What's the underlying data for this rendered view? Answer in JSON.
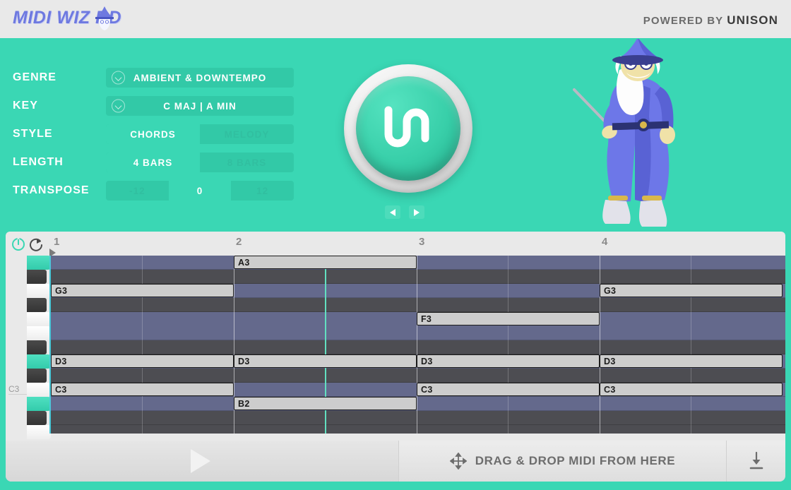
{
  "header": {
    "logo_text": "MIDI WIZ RD",
    "logo_icon": "wizard-hat-icon",
    "powered_prefix": "POWERED BY ",
    "powered_brand": "UNISON"
  },
  "controls": {
    "genre": {
      "label": "GENRE",
      "value": "AMBIENT & DOWNTEMPO",
      "icon": "chevron-down-circle-icon"
    },
    "key": {
      "label": "KEY",
      "value": "C MAJ | A MIN",
      "icon": "chevron-down-circle-icon"
    },
    "style": {
      "label": "STYLE",
      "options": [
        "CHORDS",
        "MELODY"
      ],
      "selected": "CHORDS"
    },
    "length": {
      "label": "LENGTH",
      "options": [
        "4 BARS",
        "8 BARS"
      ],
      "selected": "4 BARS"
    },
    "transpose": {
      "label": "TRANSPOSE",
      "options": [
        "-12",
        "0",
        "12"
      ],
      "selected": "0"
    }
  },
  "generate": {
    "icon": "unison-logo-icon",
    "prev_icon": "previous-arrow-icon",
    "next_icon": "next-arrow-icon"
  },
  "mascot": {
    "name": "wizard-illustration"
  },
  "piano_roll": {
    "power_icon": "power-icon",
    "loop_icon": "loop-icon",
    "bars": [
      "1",
      "2",
      "3",
      "4"
    ],
    "octave_label": "C3",
    "playhead_bar": 1.75,
    "notes": [
      {
        "name": "A3",
        "start_bar": 2.0,
        "length_bars": 1.0,
        "row": 0
      },
      {
        "name": "G3",
        "start_bar": 1.0,
        "length_bars": 1.0,
        "row": 2
      },
      {
        "name": "G3",
        "start_bar": 4.0,
        "length_bars": 1.0,
        "row": 2
      },
      {
        "name": "F3",
        "start_bar": 3.0,
        "length_bars": 1.0,
        "row": 4
      },
      {
        "name": "D3",
        "start_bar": 1.0,
        "length_bars": 1.0,
        "row": 7
      },
      {
        "name": "D3",
        "start_bar": 2.0,
        "length_bars": 1.0,
        "row": 7
      },
      {
        "name": "D3",
        "start_bar": 3.0,
        "length_bars": 1.0,
        "row": 7
      },
      {
        "name": "D3",
        "start_bar": 4.0,
        "length_bars": 1.0,
        "row": 7
      },
      {
        "name": "C3",
        "start_bar": 1.0,
        "length_bars": 1.0,
        "row": 9
      },
      {
        "name": "C3",
        "start_bar": 3.0,
        "length_bars": 1.0,
        "row": 9
      },
      {
        "name": "C3",
        "start_bar": 4.0,
        "length_bars": 1.0,
        "row": 9
      },
      {
        "name": "B2",
        "start_bar": 2.0,
        "length_bars": 1.0,
        "row": 10
      }
    ]
  },
  "bottom": {
    "play_icon": "play-icon",
    "drag_icon": "move-arrows-icon",
    "drag_text": "DRAG & DROP MIDI FROM HERE",
    "download_icon": "download-icon"
  },
  "colors": {
    "teal": "#3ad7b4",
    "teal_dark": "#32c9a7",
    "logo_purple": "#6e79e0",
    "grid_blue": "#64698c",
    "grid_dark": "#4d4d52"
  }
}
